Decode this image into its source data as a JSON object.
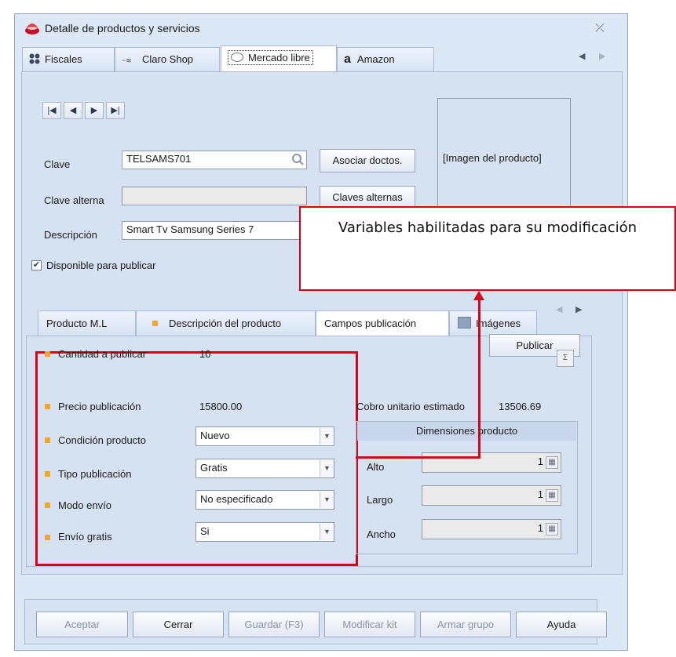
{
  "window": {
    "title": "Detalle de productos y servicios",
    "close_glyph": "⤫"
  },
  "tabs": [
    {
      "label": "Fiscales",
      "icon": "grid-icon"
    },
    {
      "label": "Claro Shop",
      "icon": "claro-shop-icon"
    },
    {
      "label": "Mercado libre",
      "icon": "mercado-libre-icon"
    },
    {
      "label": "Amazon",
      "icon": "amazon-icon"
    }
  ],
  "form": {
    "clave_label": "Clave",
    "clave_value": "TELSAMS701",
    "clave_alterna_label": "Clave alterna",
    "clave_alterna_value": "",
    "descripcion_label": "Descripción",
    "descripcion_value": "Smart Tv Samsung Series 7",
    "asociar_button": "Asociar doctos.",
    "claves_alternas_button": "Claves alternas",
    "image_placeholder": "[Imagen del producto]",
    "disponible_label": "Disponible para publicar",
    "disponible_checked": true
  },
  "callout": {
    "text": "Variables habilitadas para su modificación"
  },
  "subtabs": [
    {
      "label": "Producto M.L"
    },
    {
      "label": "Descripción del producto"
    },
    {
      "label": "Campos publicación"
    },
    {
      "label": "Imágenes"
    }
  ],
  "publicar_button": "Publicar",
  "fields": {
    "cantidad_label": "Cantidad a publicar",
    "cantidad_value": "10",
    "precio_label": "Precio publicación",
    "precio_value": "15800.00",
    "condicion_label": "Condición producto",
    "condicion_value": "Nuevo",
    "tipo_label": "Tipo publicación",
    "tipo_value": "Gratis",
    "modo_label": "Modo envío",
    "modo_value": "No especificado",
    "envio_label": "Envío gratis",
    "envio_value": "Si"
  },
  "cobro": {
    "label": "Cobro unitario estimado",
    "value": "13506.69"
  },
  "dimensiones": {
    "header": "Dimensiones producto",
    "alto_label": "Alto",
    "alto_value": "1",
    "largo_label": "Largo",
    "largo_value": "1",
    "ancho_label": "Ancho",
    "ancho_value": "1"
  },
  "footer": {
    "aceptar": "Aceptar",
    "cerrar": "Cerrar",
    "guardar": "Guardar (F3)",
    "modificar_kit": "Modificar kit",
    "armar_grupo": "Armar grupo",
    "ayuda": "Ayuda"
  },
  "colors": {
    "highlight_red": "#d9001a",
    "bullet_orange": "#f5a623",
    "window_bg": "#dde8f6"
  }
}
